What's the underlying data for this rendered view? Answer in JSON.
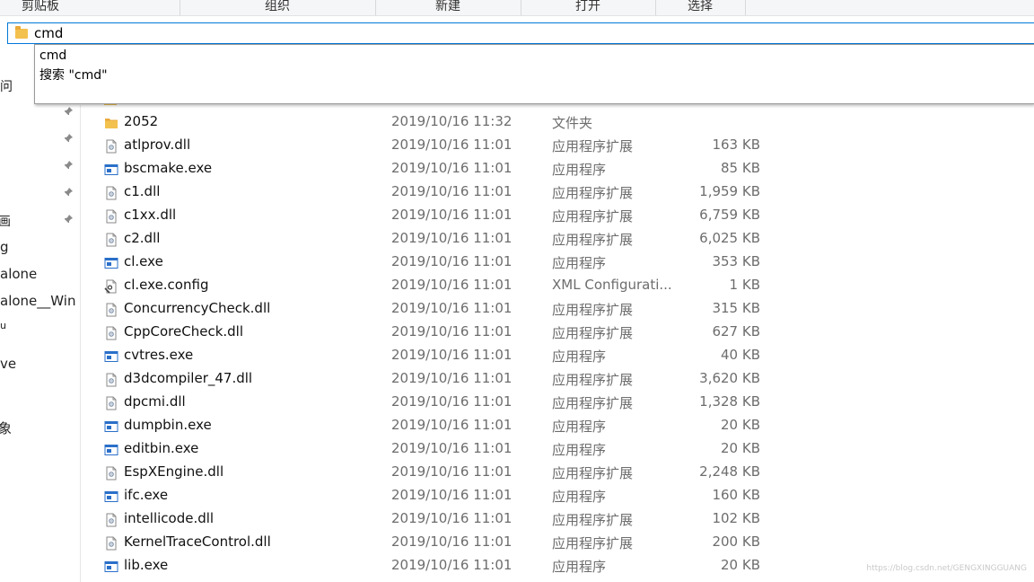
{
  "ribbon": {
    "groups": [
      "剪贴板",
      "组织",
      "新建",
      "打开",
      "选择"
    ]
  },
  "address_bar": {
    "value": "cmd",
    "icon": "folder-icon"
  },
  "autocomplete": {
    "options": [
      "cmd",
      "搜索 \"cmd\""
    ]
  },
  "nav": {
    "top_fragment": "问",
    "items": [
      "画",
      "g",
      "alone",
      "alone__Win",
      "u",
      "ve",
      "象"
    ],
    "pin_icon": "pin-icon"
  },
  "files": [
    {
      "name": "2052",
      "date": "2019/10/16 11:32",
      "type": "文件夹",
      "size": "",
      "icon": "folder-icon"
    },
    {
      "name": "atlprov.dll",
      "date": "2019/10/16 11:01",
      "type": "应用程序扩展",
      "size": "163 KB",
      "icon": "dll-icon"
    },
    {
      "name": "bscmake.exe",
      "date": "2019/10/16 11:01",
      "type": "应用程序",
      "size": "85 KB",
      "icon": "exe-icon"
    },
    {
      "name": "c1.dll",
      "date": "2019/10/16 11:01",
      "type": "应用程序扩展",
      "size": "1,959 KB",
      "icon": "dll-icon"
    },
    {
      "name": "c1xx.dll",
      "date": "2019/10/16 11:01",
      "type": "应用程序扩展",
      "size": "6,759 KB",
      "icon": "dll-icon"
    },
    {
      "name": "c2.dll",
      "date": "2019/10/16 11:01",
      "type": "应用程序扩展",
      "size": "6,025 KB",
      "icon": "dll-icon"
    },
    {
      "name": "cl.exe",
      "date": "2019/10/16 11:01",
      "type": "应用程序",
      "size": "353 KB",
      "icon": "exe-icon"
    },
    {
      "name": "cl.exe.config",
      "date": "2019/10/16 11:01",
      "type": "XML Configurati...",
      "size": "1 KB",
      "icon": "config-icon"
    },
    {
      "name": "ConcurrencyCheck.dll",
      "date": "2019/10/16 11:01",
      "type": "应用程序扩展",
      "size": "315 KB",
      "icon": "dll-icon"
    },
    {
      "name": "CppCoreCheck.dll",
      "date": "2019/10/16 11:01",
      "type": "应用程序扩展",
      "size": "627 KB",
      "icon": "dll-icon"
    },
    {
      "name": "cvtres.exe",
      "date": "2019/10/16 11:01",
      "type": "应用程序",
      "size": "40 KB",
      "icon": "exe-icon"
    },
    {
      "name": "d3dcompiler_47.dll",
      "date": "2019/10/16 11:01",
      "type": "应用程序扩展",
      "size": "3,620 KB",
      "icon": "dll-icon"
    },
    {
      "name": "dpcmi.dll",
      "date": "2019/10/16 11:01",
      "type": "应用程序扩展",
      "size": "1,328 KB",
      "icon": "dll-icon"
    },
    {
      "name": "dumpbin.exe",
      "date": "2019/10/16 11:01",
      "type": "应用程序",
      "size": "20 KB",
      "icon": "exe-icon"
    },
    {
      "name": "editbin.exe",
      "date": "2019/10/16 11:01",
      "type": "应用程序",
      "size": "20 KB",
      "icon": "exe-icon"
    },
    {
      "name": "EspXEngine.dll",
      "date": "2019/10/16 11:01",
      "type": "应用程序扩展",
      "size": "2,248 KB",
      "icon": "dll-icon"
    },
    {
      "name": "ifc.exe",
      "date": "2019/10/16 11:01",
      "type": "应用程序",
      "size": "160 KB",
      "icon": "exe-icon"
    },
    {
      "name": "intellicode.dll",
      "date": "2019/10/16 11:01",
      "type": "应用程序扩展",
      "size": "102 KB",
      "icon": "dll-icon"
    },
    {
      "name": "KernelTraceControl.dll",
      "date": "2019/10/16 11:01",
      "type": "应用程序扩展",
      "size": "200 KB",
      "icon": "dll-icon"
    },
    {
      "name": "lib.exe",
      "date": "2019/10/16 11:01",
      "type": "应用程序",
      "size": "20 KB",
      "icon": "exe-icon"
    }
  ],
  "watermark": "https://blog.csdn.net/GENGXINGGUANG",
  "colors": {
    "accent": "#0078d7",
    "folder": "#f3c14e",
    "exe_blue": "#2a6fc9"
  }
}
